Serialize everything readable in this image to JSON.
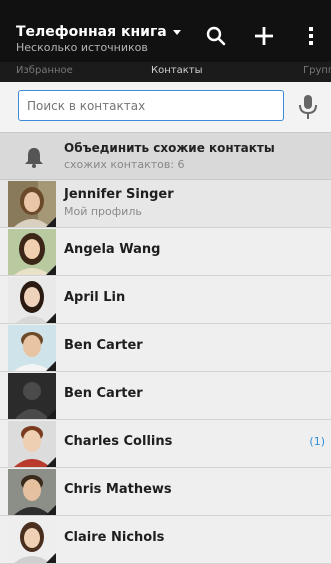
{
  "header": {
    "title": "Телефонная книга",
    "subtitle": "Несколько источников",
    "icons": [
      "search-icon",
      "add-icon",
      "overflow-menu-icon"
    ]
  },
  "tabs": [
    {
      "label": "Избранное"
    },
    {
      "label": "Контакты"
    },
    {
      "label": "Группы"
    }
  ],
  "search": {
    "placeholder": "Поиск в контактах"
  },
  "merge": {
    "title": "Объединить схожие контакты",
    "subtitle": "схожих контактов: 6"
  },
  "contacts": [
    {
      "name": "Jennifer Singer",
      "subtitle": "Мой профиль"
    },
    {
      "name": "Angela Wang"
    },
    {
      "name": "April Lin"
    },
    {
      "name": "Ben Carter"
    },
    {
      "name": "Ben Carter"
    },
    {
      "name": "Charles Collins",
      "count": "(1)"
    },
    {
      "name": "Chris Mathews"
    },
    {
      "name": "Claire Nichols"
    }
  ],
  "colors": {
    "accent": "#3d8ad7",
    "count": "#2f8fd6",
    "header": "#111111"
  }
}
